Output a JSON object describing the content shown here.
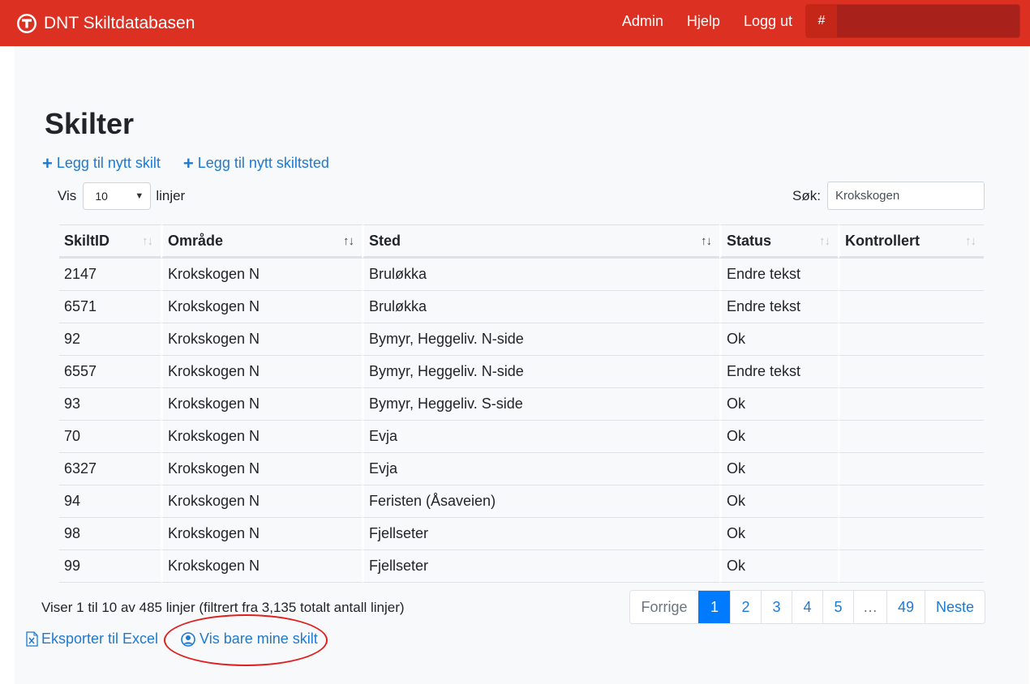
{
  "navbar": {
    "brand": "DNT Skiltdatabasen",
    "links": [
      "Admin",
      "Hjelp",
      "Logg ut"
    ],
    "hash_label": "#"
  },
  "page": {
    "title": "Skilter",
    "add_sign": "Legg til nytt skilt",
    "add_location": "Legg til nytt skiltsted"
  },
  "length": {
    "prefix": "Vis",
    "value": "10",
    "suffix": "linjer"
  },
  "search": {
    "label": "Søk:",
    "value": "Krokskogen"
  },
  "table": {
    "headers": [
      "SkiltID",
      "Område",
      "Sted",
      "Status",
      "Kontrollert"
    ],
    "rows": [
      [
        "2147",
        "Krokskogen N",
        "Bruløkka",
        "Endre tekst",
        ""
      ],
      [
        "6571",
        "Krokskogen N",
        "Bruløkka",
        "Endre tekst",
        ""
      ],
      [
        "92",
        "Krokskogen N",
        "Bymyr, Heggeliv. N-side",
        "Ok",
        ""
      ],
      [
        "6557",
        "Krokskogen N",
        "Bymyr, Heggeliv. N-side",
        "Endre tekst",
        ""
      ],
      [
        "93",
        "Krokskogen N",
        "Bymyr, Heggeliv. S-side",
        "Ok",
        ""
      ],
      [
        "70",
        "Krokskogen N",
        "Evja",
        "Ok",
        ""
      ],
      [
        "6327",
        "Krokskogen N",
        "Evja",
        "Ok",
        ""
      ],
      [
        "94",
        "Krokskogen N",
        "Feristen (Åsaveien)",
        "Ok",
        ""
      ],
      [
        "98",
        "Krokskogen N",
        "Fjellseter",
        "Ok",
        ""
      ],
      [
        "99",
        "Krokskogen N",
        "Fjellseter",
        "Ok",
        ""
      ]
    ]
  },
  "info": "Viser 1 til 10 av 485 linjer (filtrert fra 3,135 totalt antall linjer)",
  "pagination": {
    "previous": "Forrige",
    "pages": [
      "1",
      "2",
      "3",
      "4",
      "5",
      "…",
      "49"
    ],
    "next": "Neste",
    "active": "1"
  },
  "bottom": {
    "export": "Eksporter til Excel",
    "mine": "Vis bare mine skilt"
  },
  "colors": {
    "navbar": "#dc3022",
    "link": "#1e7ad1",
    "active_page": "#007bff",
    "highlight": "#e02020"
  }
}
